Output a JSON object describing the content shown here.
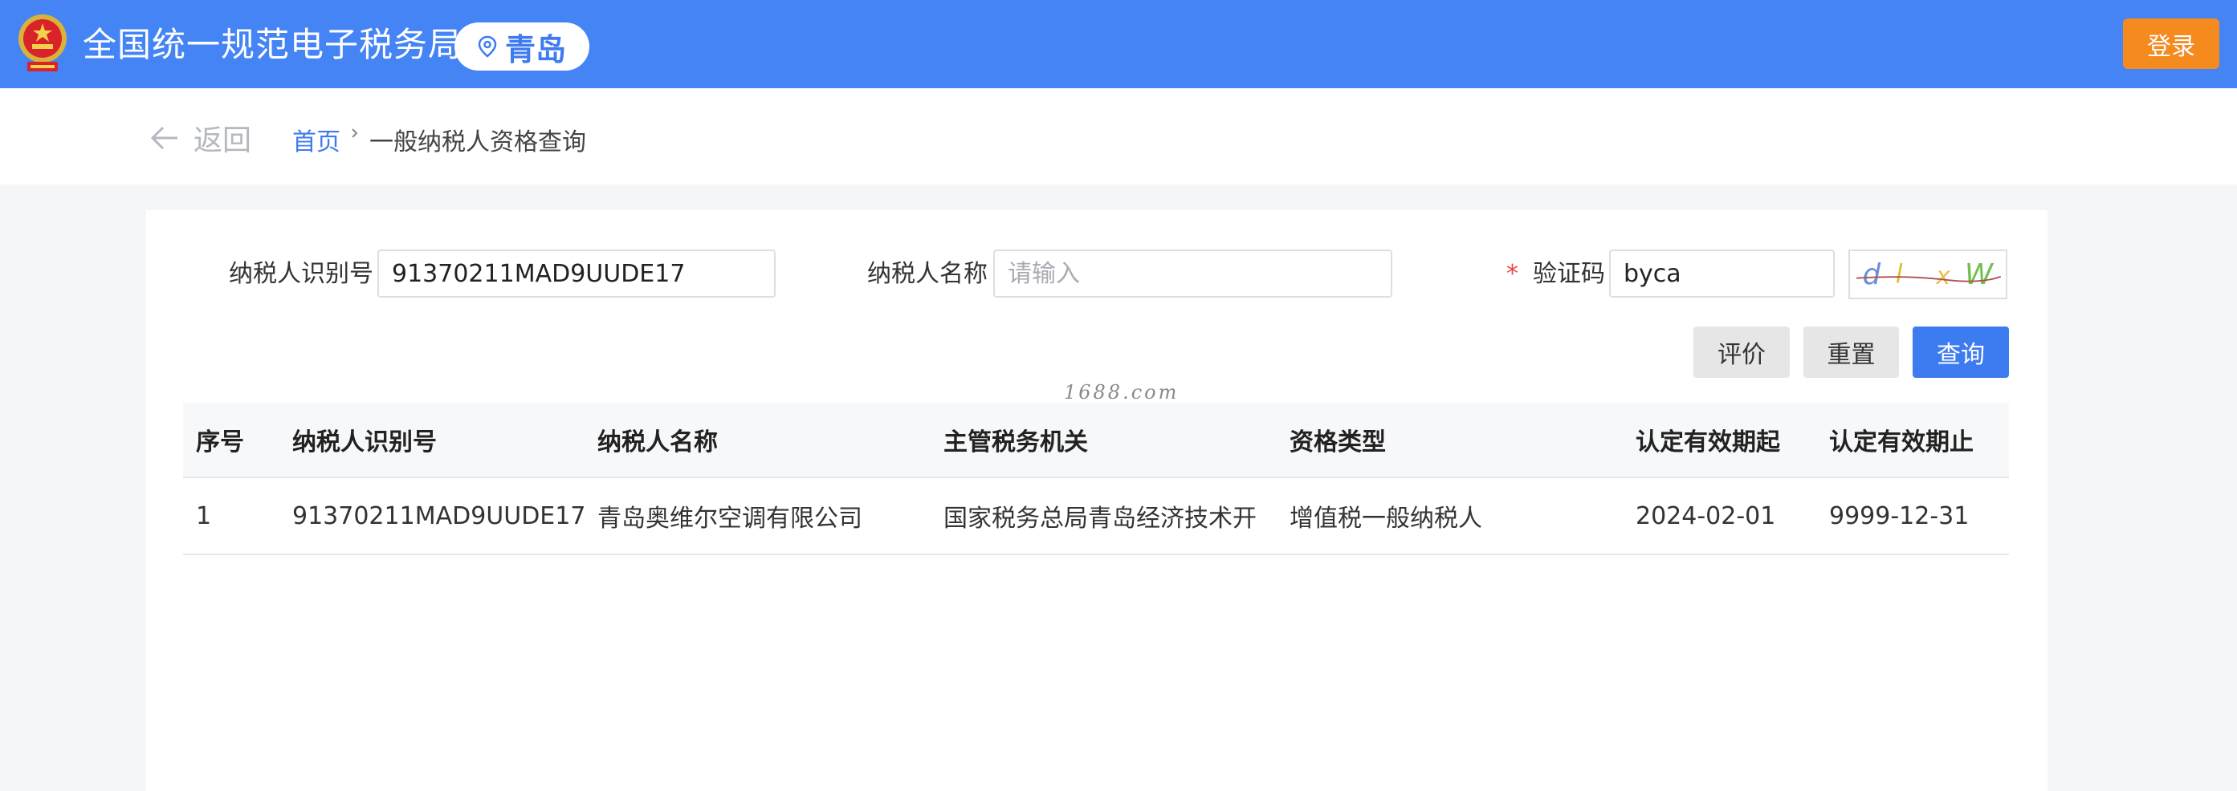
{
  "header": {
    "site_title": "全国统一规范电子税务局",
    "region": "青岛",
    "login_label": "登录"
  },
  "breadcrumb": {
    "back_label": "返回",
    "home": "首页",
    "current": "一般纳税人资格查询"
  },
  "form": {
    "taxpayer_id_label": "纳税人识别号",
    "taxpayer_id_value": "91370211MAD9UUDE17",
    "taxpayer_name_label": "纳税人名称",
    "taxpayer_name_placeholder": "请输入",
    "captcha_required_mark": "*",
    "captcha_label": "验证码",
    "captcha_value": "byca",
    "captcha_image_chars": [
      "d",
      "l",
      "x",
      "W"
    ]
  },
  "actions": {
    "evaluate": "评价",
    "reset": "重置",
    "query": "查询"
  },
  "watermark": "1688.com",
  "table": {
    "columns": [
      "序号",
      "纳税人识别号",
      "纳税人名称",
      "主管税务机关",
      "资格类型",
      "认定有效期起",
      "认定有效期止"
    ],
    "rows": [
      [
        "1",
        "91370211MAD9UUDE17",
        "青岛奥维尔空调有限公司",
        "国家税务总局青岛经济技术开...",
        "增值税一般纳税人",
        "2024-02-01",
        "9999-12-31"
      ]
    ]
  },
  "colors": {
    "header_bg": "#4584f5",
    "login_bg": "#f58a1f",
    "primary": "#3d7bf0",
    "required": "#e84545"
  }
}
